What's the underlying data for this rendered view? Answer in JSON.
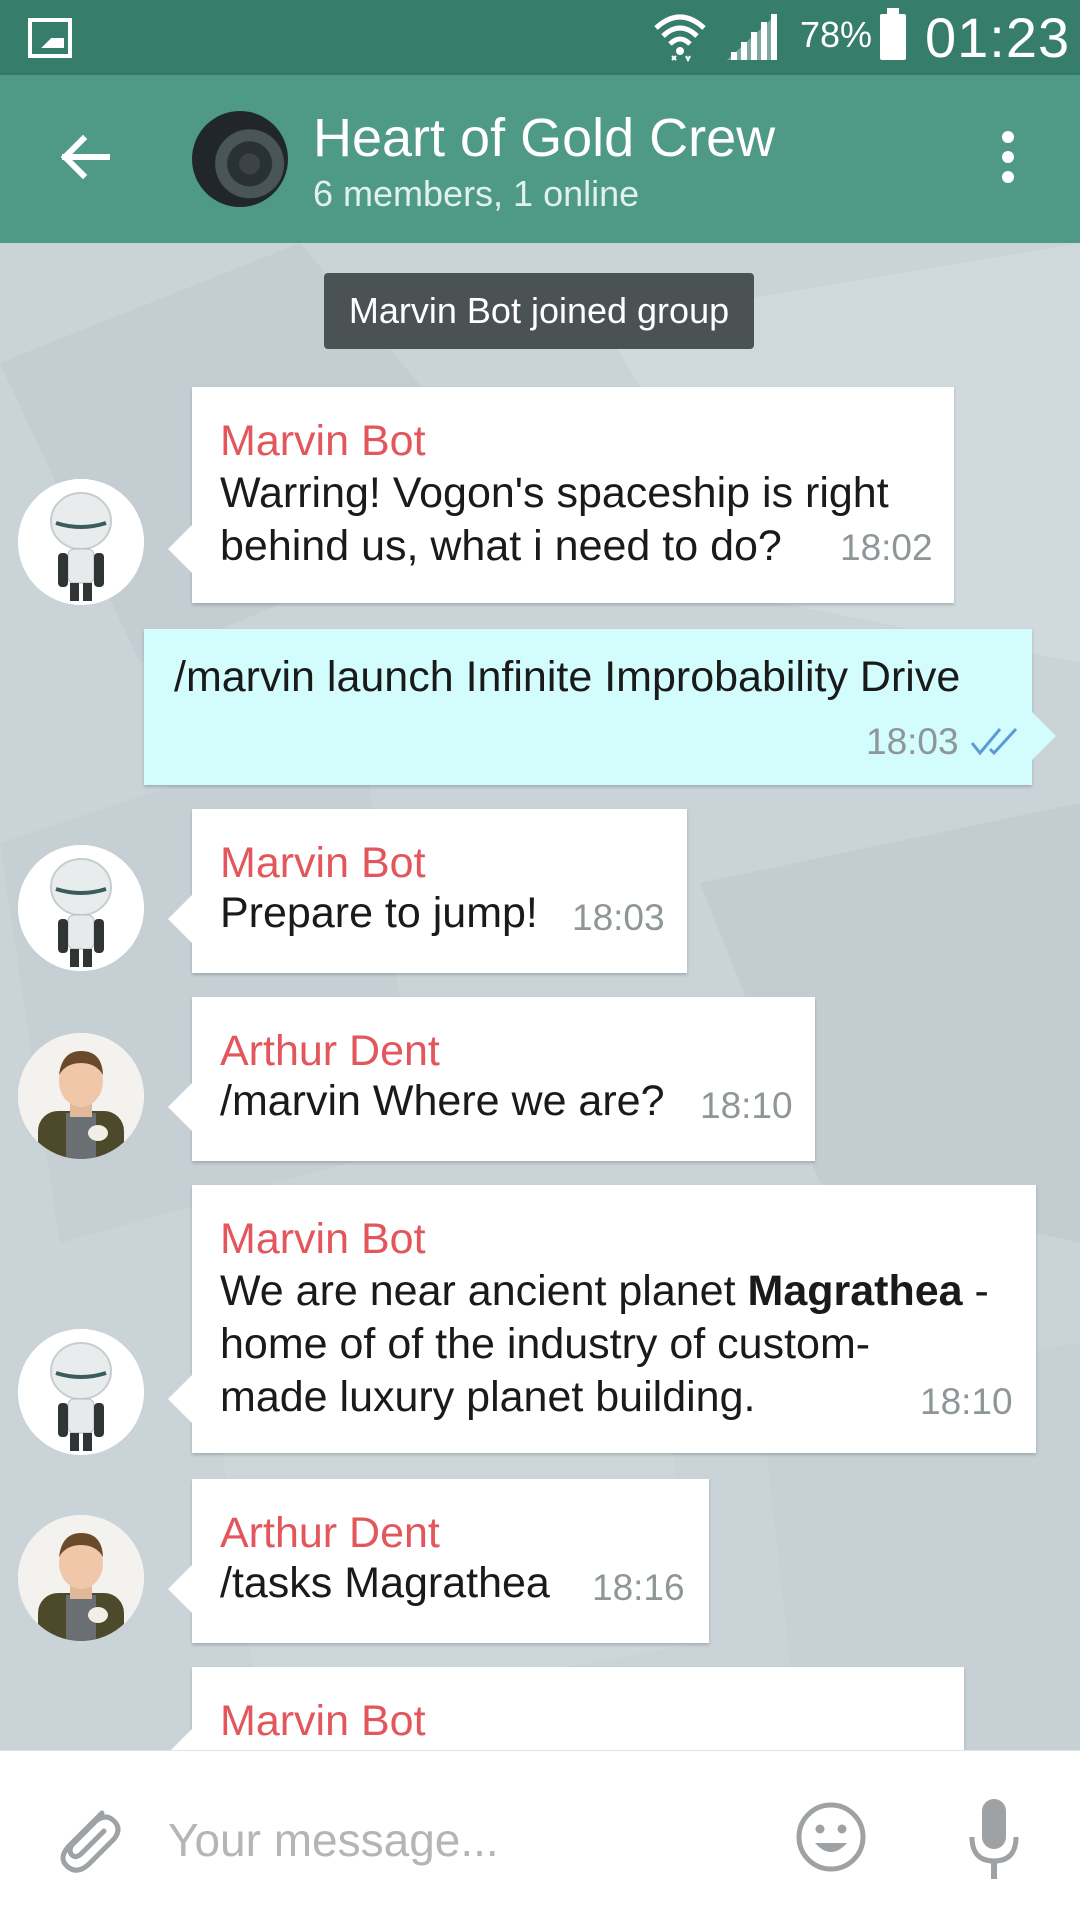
{
  "status_bar": {
    "battery": "78%",
    "time": "01:23"
  },
  "header": {
    "title": "Heart of Gold Crew",
    "subtitle": "6 members, 1 online"
  },
  "service_message": "Marvin Bot joined group",
  "messages": [
    {
      "sender": "Marvin Bot",
      "lines": [
        "Warring! Vogon's spaceship is right",
        "behind us, what i need to do?"
      ],
      "time": "18:02"
    },
    {
      "outgoing": true,
      "text": "/marvin launch Infinite Improbability Drive",
      "time": "18:03"
    },
    {
      "sender": "Marvin Bot",
      "text": "Prepare to jump!",
      "time": "18:03"
    },
    {
      "sender": "Arthur Dent",
      "text": "/marvin Where we are?",
      "time": "18:10"
    },
    {
      "sender": "Marvin Bot",
      "line1_before": "We are near ancient planet ",
      "line1_bold": "Magrathea",
      "line1_after": " -",
      "line2": "home of of the industry of custom-",
      "line3": "made luxury planet building.",
      "time": "18:10"
    },
    {
      "sender": "Arthur Dent",
      "text": "/tasks Magrathea",
      "time": "18:16"
    },
    {
      "sender": "Marvin Bot"
    }
  ],
  "composer": {
    "placeholder": "Your message..."
  },
  "colors": {
    "status_bar": "#367d6b",
    "toolbar": "#4e9a86",
    "sender_name": "#e2565c",
    "outgoing_bubble": "#d3fcfc",
    "read_ticks": "#5b9bd5"
  }
}
